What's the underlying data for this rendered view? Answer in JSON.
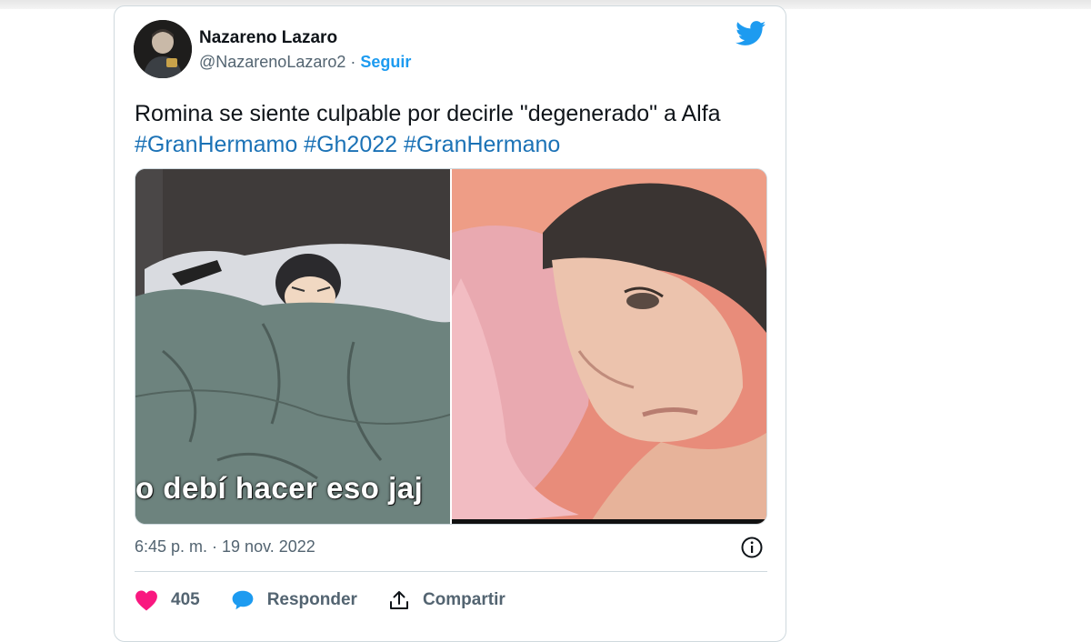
{
  "author": {
    "name": "Nazareno Lazaro",
    "handle": "@NazarenoLazaro2",
    "separator": " · ",
    "follow_label": "Seguir"
  },
  "tweet": {
    "text": "Romina se siente culpable por decirle \"degenerado\" a Alfa",
    "hashtags": "#GranHermamo #Gh2022 #GranHermano",
    "timestamp": "6:45 p. m. · 19 nov. 2022"
  },
  "media": {
    "caption": "o debí hacer eso jaj"
  },
  "actions": {
    "like_count": "405",
    "reply_label": "Responder",
    "share_label": "Compartir"
  },
  "colors": {
    "accent": "#1d9bf0",
    "hashtag": "#1b72b6",
    "like": "#f91880",
    "reply": "#1d9bf0",
    "secondary_text": "#536471"
  },
  "icons": [
    "twitter-bird-icon",
    "info-icon",
    "heart-icon",
    "reply-bubble-icon",
    "share-icon"
  ]
}
